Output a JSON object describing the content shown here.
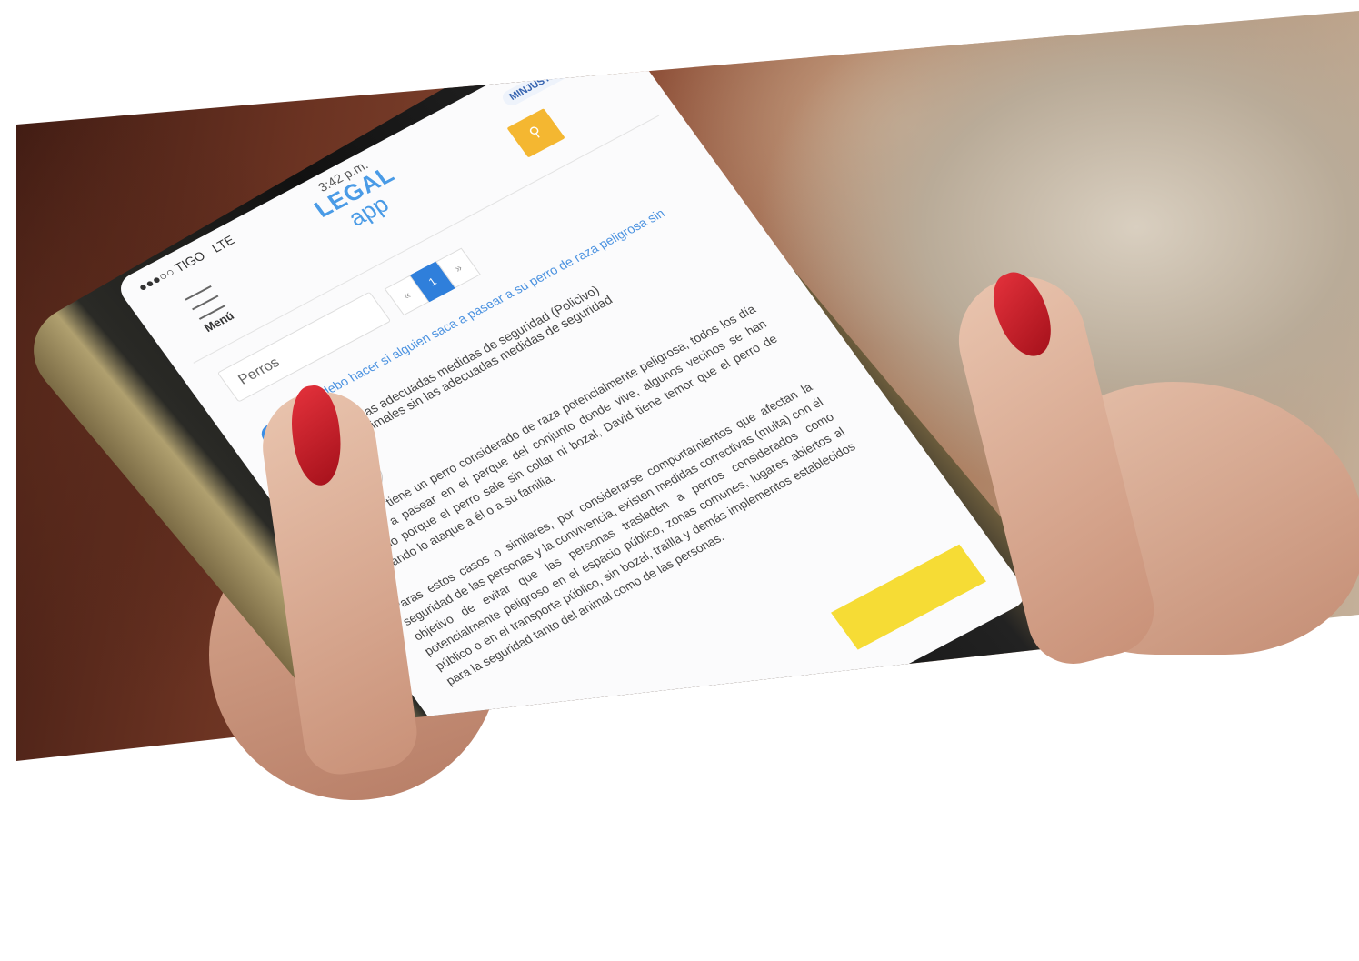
{
  "status": {
    "carrier": "●●●○○ TIGO",
    "network": "LTE"
  },
  "header": {
    "time": "3:42 p.m.",
    "logo_word": "LEGAL",
    "logo_app": "app",
    "ministry": "MINJUSTICIA",
    "menu_label": "Menú",
    "search_icon": "search-icon"
  },
  "search": {
    "value": "Perros"
  },
  "pager": {
    "prev": "«",
    "current": "1",
    "next": "»"
  },
  "result": {
    "title": "¿Qué debo hacer si alguien saca a pasear a su perro de raza peligrosa sin bozal?",
    "subtitle_line1": "No tomar las adecuadas medidas de seguridad (Policivo)",
    "subtitle_line2": "pasear animales sin las adecuadas medidas de seguridad"
  },
  "buttons": {
    "audio": "◂",
    "favorite": "★"
  },
  "body": {
    "p1": "Fernando tiene un perro considerado de raza potencialmente peligrosa, todos los día lo saca a pasear en el parque del conjunto donde vive, algunos vecinos se han quejado porque el perro sale sin collar ni bozal, David tiene temor que el perro de Fernando lo ataque a él o a su familia.",
    "p2": "Paras estos casos o similares, por considerarse comportamientos que afectan la seguridad de las personas y la convivencia, existen medidas correctivas (multa) con él objetivo de evitar que las personas trasladen a perros considerados como potencialmente peligroso en el espacio público, zonas comunes, lugares abiertos al público o en el transporte público, sin bozal, traílla y demás implementos establecidos para la seguridad tanto del animal como de las personas."
  }
}
